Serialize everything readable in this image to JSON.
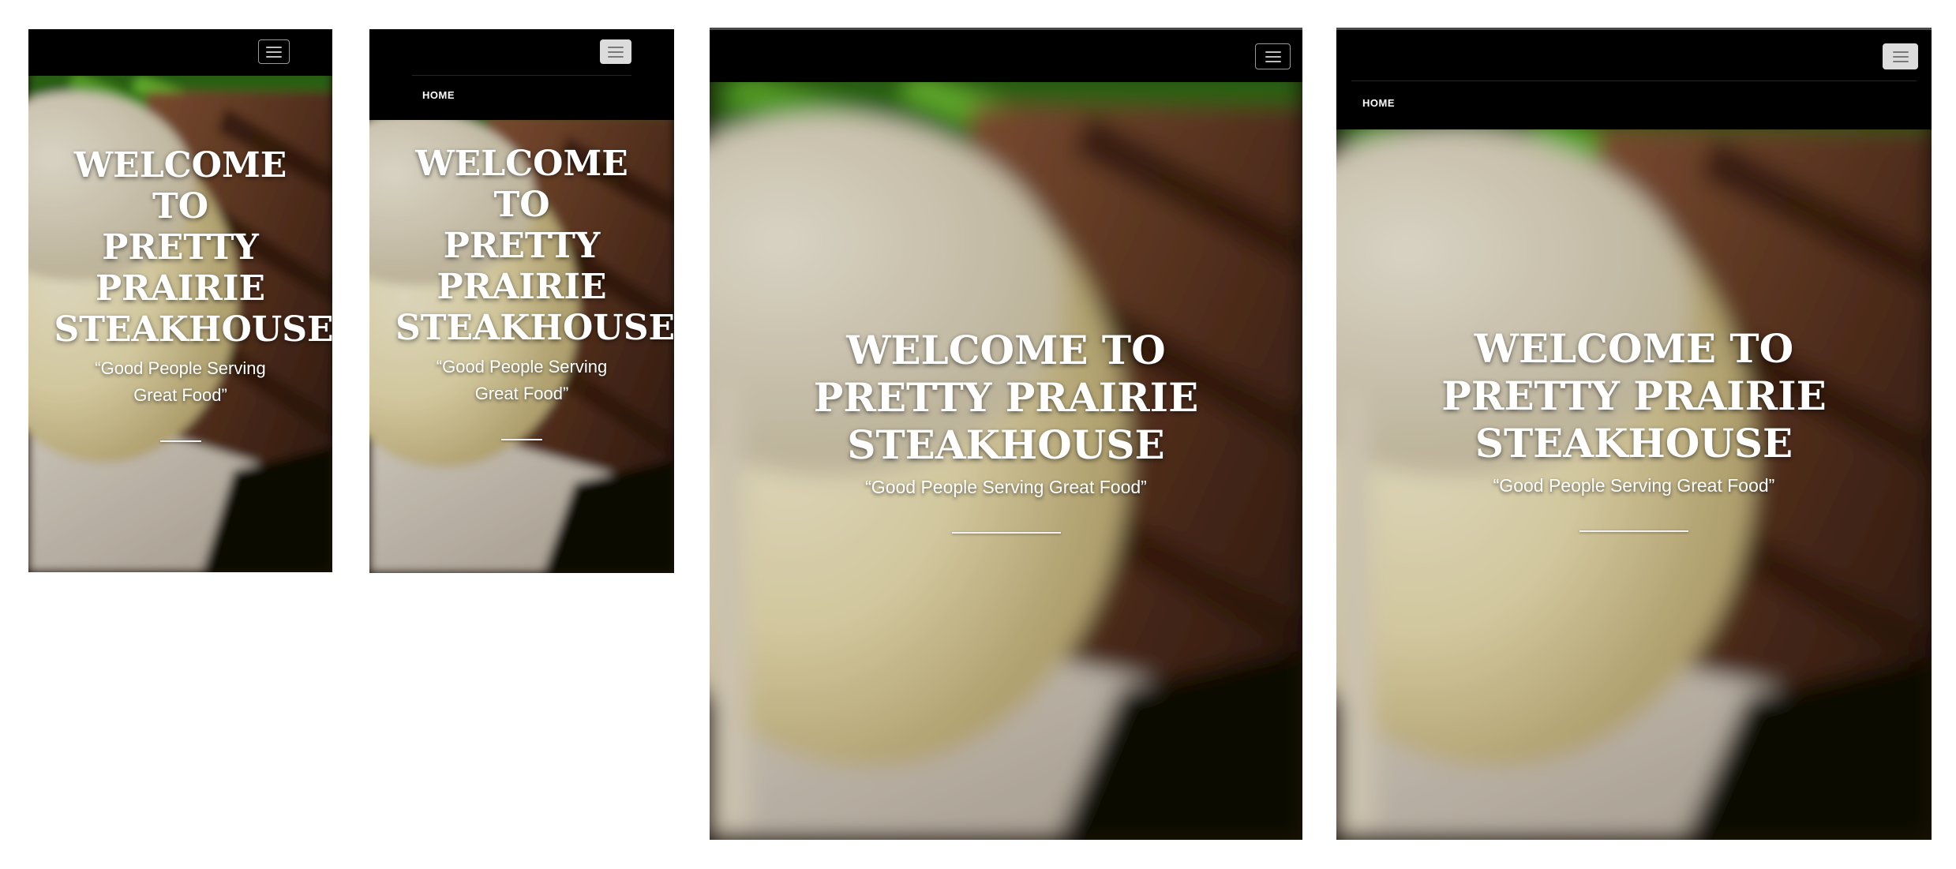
{
  "brand_colors": {
    "navbar": "#000000",
    "hero_text": "#ffffff",
    "toggler_open_bg": "#dcdcdc"
  },
  "icons": {
    "menu": "hamburger-icon"
  },
  "nav": {
    "home_label": "HOME"
  },
  "hero": {
    "title": "WELCOME TO PRETTY PRAIRIE STEAKHOUSE",
    "title_mobile_lines": [
      "WELCOME",
      "TO",
      "PRETTY",
      "PRAIRIE",
      "STEAKHOUSE"
    ],
    "title_wide_lines": [
      "WELCOME TO",
      "PRETTY PRAIRIE",
      "STEAKHOUSE"
    ],
    "tagline": "“Good People Serving Great Food”",
    "tagline_mobile_lines": [
      "“Good People Serving",
      "Great Food”"
    ]
  },
  "views": [
    {
      "id": "mobile-collapsed",
      "menu_open": false
    },
    {
      "id": "mobile-expanded",
      "menu_open": true
    },
    {
      "id": "tablet-collapsed",
      "menu_open": false
    },
    {
      "id": "tablet-expanded",
      "menu_open": true
    }
  ]
}
